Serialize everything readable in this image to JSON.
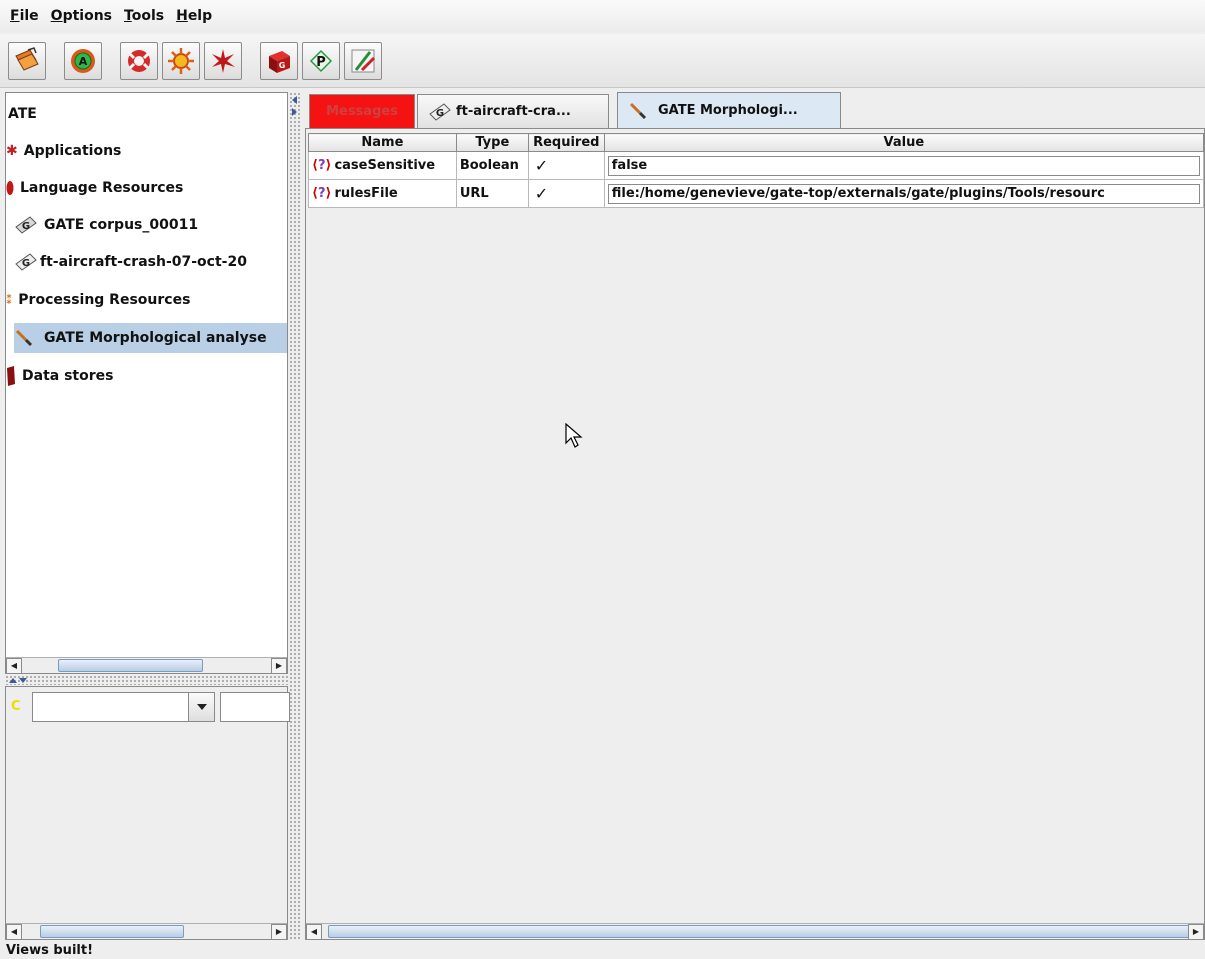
{
  "menu": [
    "File",
    "Options",
    "Tools",
    "Help"
  ],
  "tree": {
    "root": "ATE",
    "applications": "Applications",
    "language_resources": "Language Resources",
    "lr_items": [
      "GATE corpus_00011",
      "ft-aircraft-crash-07-oct-20"
    ],
    "processing_resources": "Processing Resources",
    "pr_items": [
      "GATE Morphological analyse"
    ],
    "data_stores": "Data stores"
  },
  "tabs": [
    "Messages",
    "ft-aircraft-cra...",
    "GATE Morphologi..."
  ],
  "table": {
    "headers": [
      "Name",
      "Type",
      "Required",
      "Value"
    ],
    "rows": [
      {
        "name": "caseSensitive",
        "type": "Boolean",
        "required": "✓",
        "value": "false"
      },
      {
        "name": "rulesFile",
        "type": "URL",
        "required": "✓",
        "value": "file:/home/genevieve/gate-top/externals/gate/plugins/Tools/resourc"
      }
    ]
  },
  "status": "Views built!",
  "colors": {
    "selection": "#b8cfe5",
    "messages_tab": "#f41212"
  }
}
